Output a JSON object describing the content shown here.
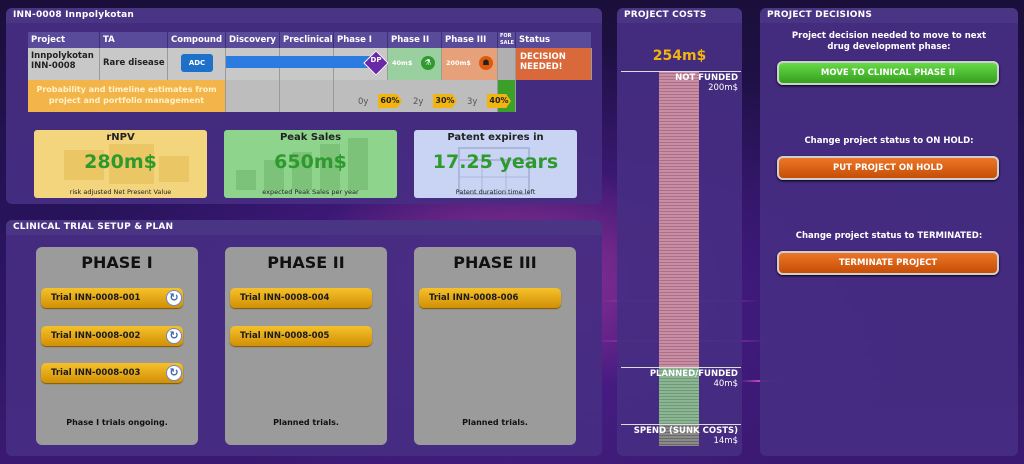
{
  "project_panel": {
    "title": "INN-0008 Innpolykotan",
    "headers": [
      "Project",
      "TA",
      "Compound",
      "Discovery",
      "Preclinical",
      "Phase I",
      "Phase II",
      "Phase III",
      "FOR SALE",
      "Status"
    ],
    "project_name": "Innpolykotan",
    "project_id": "INN-0008",
    "ta": "Rare disease",
    "compound_logo": "ADC",
    "phase1_badge": "DP",
    "phase2_cost": "40m$",
    "phase3_cost": "200m$",
    "status": "DECISION NEEDED!",
    "prob_note": "Probability and timeline estimates from project and portfolio management",
    "timeline": [
      {
        "years": "0y",
        "prob": "60%"
      },
      {
        "years": "2y",
        "prob": "30%"
      },
      {
        "years": "3y",
        "prob": "40%"
      }
    ]
  },
  "kpis": [
    {
      "title": "rNPV",
      "value": "280m$",
      "caption": "risk adjusted Net Present Value",
      "color": "#f3d57e"
    },
    {
      "title": "Peak Sales",
      "value": "650m$",
      "caption": "expected Peak Sales per year",
      "color": "#8fd48c"
    },
    {
      "title": "Patent expires in",
      "value": "17.25 years",
      "caption": "Patent duration time left",
      "color": "#c9d4f5"
    }
  ],
  "clinical_panel": {
    "title": "CLINICAL TRIAL SETUP & PLAN",
    "phases": [
      {
        "title": "PHASE I",
        "trials": [
          "Trial INN-0008-001",
          "Trial INN-0008-002",
          "Trial INN-0008-003"
        ],
        "note": "Phase I trials ongoing."
      },
      {
        "title": "PHASE II",
        "trials": [
          "Trial INN-0008-004",
          "Trial INN-0008-005"
        ],
        "note": "Planned trials."
      },
      {
        "title": "PHASE III",
        "trials": [
          "Trial INN-0008-006"
        ],
        "note": "Planned trials."
      }
    ]
  },
  "costs_panel": {
    "title": "PROJECT COSTS",
    "total": "254m$",
    "not_funded_label": "NOT FUNDED",
    "not_funded_value": "200m$",
    "planned_label": "PLANNED/FUNDED",
    "planned_value": "40m$",
    "spend_label": "SPEND (SUNK COSTS)",
    "spend_value": "14m$",
    "values": {
      "not_funded": 200,
      "planned": 40,
      "spend": 14
    }
  },
  "decisions_panel": {
    "title": "PROJECT DECISIONS",
    "items": [
      {
        "text": "Project decision needed to move to next drug development phase:",
        "button": "MOVE TO CLINICAL PHASE II",
        "color": "#3fb92a"
      },
      {
        "text": "Change project status to ON HOLD:",
        "button": "PUT PROJECT ON HOLD",
        "color": "#e05a0a"
      },
      {
        "text": "Change project status to TERMINATED:",
        "button": "TERMINATE PROJECT",
        "color": "#e05a0a"
      }
    ]
  }
}
